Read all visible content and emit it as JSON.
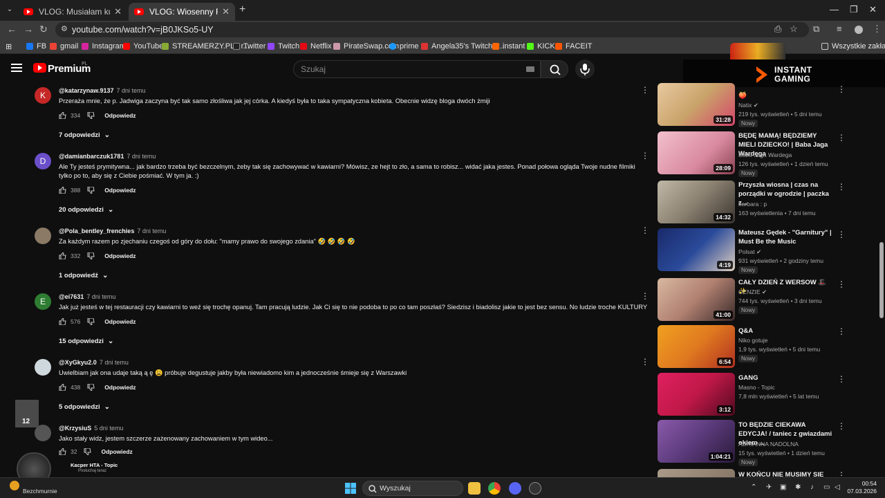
{
  "browser": {
    "tabs": [
      {
        "title": "VLOG: Musiałam kupić drugi ro"
      },
      {
        "title": "VLOG: Wiosenny Reset Pokoju"
      }
    ],
    "url": "youtube.com/watch?v=jB0JKSo5-UY",
    "all_bookmarks_label": "Wszystkie zakładki",
    "bookmarks": [
      {
        "label": "FB",
        "color": "#1877f2"
      },
      {
        "label": "gmail",
        "color": "#ea4335"
      },
      {
        "label": "Instagram",
        "color": "#d6249f"
      },
      {
        "label": "YouTube",
        "color": "#ff0000"
      },
      {
        "label": "STREAMERZY.PL - r...",
        "color": "#8a3"
      },
      {
        "label": "Twitter",
        "color": "#222"
      },
      {
        "label": "Twitch",
        "color": "#9146ff"
      },
      {
        "label": "Netflix",
        "color": "#e50914"
      },
      {
        "label": "PirateSwap.com",
        "color": "#c9a"
      },
      {
        "label": "prime",
        "color": "#1a98ff"
      },
      {
        "label": "Angela35's Twitch R...",
        "color": "#d33"
      },
      {
        "label": "instant",
        "color": "#f60"
      },
      {
        "label": "KICK",
        "color": "#53fc18"
      },
      {
        "label": "FACEIT",
        "color": "#ff5500"
      }
    ]
  },
  "youtube": {
    "logo_text": "Premium",
    "logo_region": "PL",
    "search_placeholder": "Szukaj"
  },
  "ad_banner": {
    "line1": "INSTANT",
    "line2": "GAMING"
  },
  "comments": [
    {
      "author": "@katarzynaw.9137",
      "date": "7 dni temu",
      "text": "Przeraża mnie, że p. Jadwiga zaczyna być tak samo złośliwa jak jej córka. A kiedyś była to taka sympatyczna kobieta. Obecnie widzę bloga dwóch żmiji",
      "likes": "334",
      "reply_label": "Odpowiedz",
      "replies": "7 odpowiedzi",
      "avatar_letter": "K",
      "avatar_color": "#c62828"
    },
    {
      "author": "@damianbarczuk1781",
      "date": "7 dni temu",
      "text": "Ale Ty jesteś prymitywna... jak bardzo trzeba być bezczelnym, żeby tak się zachowywać w kawiarni? Mówisz, ze hejt to zło, a sama to robisz... widać jaka jestes. Ponad połowa ogląda Twoje nudne filmiki tylko po to, aby się z Ciebie pośmiać. W tym ja. :)",
      "likes": "388",
      "reply_label": "Odpowiedz",
      "replies": "20 odpowiedzi",
      "avatar_letter": "D",
      "avatar_color": "#6a4fc9"
    },
    {
      "author": "@Pola_bentley_frenchies",
      "date": "7 dni temu",
      "text": "Za każdym razem po zjechaniu czegoś od góry do dołu: \"mamy prawo do swojego zdania\" 🤣 🤣 🤣 🤣",
      "likes": "332",
      "reply_label": "Odpowiedz",
      "replies": "1 odpowiedź",
      "avatar_letter": "",
      "avatar_color": "#8a7a66"
    },
    {
      "author": "@ei7631",
      "date": "7 dni temu",
      "text": "Jak już jesteś w tej restauracji czy kawiarni to weź się trochę opanuj.  Tam pracują ludzie. Jak Ci się to nie podoba to po co tam poszłaś? Siedzisz i biadolisz jakie to jest bez sensu. No ludzie troche KULTURY",
      "likes": "576",
      "reply_label": "Odpowiedz",
      "replies": "15 odpowiedzi",
      "avatar_letter": "E",
      "avatar_color": "#2e7d32"
    },
    {
      "author": "@XyGkyu2.0",
      "date": "7 dni temu",
      "text": "Uwielbiam jak ona udaje taką ą ę 😩 próbuje degustuje jakby była niewiadomo kim a jednocześnie śmieje się z Warszawki",
      "likes": "438",
      "reply_label": "Odpowiedz",
      "replies": "5 odpowiedzi",
      "avatar_letter": "",
      "avatar_color": "#cfd8dc"
    },
    {
      "author": "@KrzysiuS",
      "date": "5 dni temu",
      "text": "Jako stały widz, jestem szczerze zażenowany zachowaniem w tym wideo...",
      "likes": "32",
      "reply_label": "Odpowiedz",
      "replies": "",
      "avatar_letter": "",
      "avatar_color": "#555"
    }
  ],
  "recommendations": [
    {
      "title": "🍑",
      "channel": "Natix ✔",
      "meta": "219 tys. wyświetleń • 5 dni temu",
      "badge": "Nowy",
      "duration": "31:28",
      "thumb": "#c9a36a"
    },
    {
      "title": "BĘDĘ MAMĄ! BĘDZIEMY MIELI DZIECKO! | Baba Jaga Wardęga",
      "channel": "Baba Jaga Wardega",
      "meta": "126 tys. wyświetleń • 1 dzień temu",
      "badge": "Nowy",
      "duration": "28:09",
      "thumb": "#d98aa0"
    },
    {
      "title": "Przyszła wiosna | czas na porządki w ogrodzie | paczka z...",
      "channel": "barbara : p",
      "meta": "163 wyświetlenia • 7 dni temu",
      "badge": "",
      "duration": "14:32",
      "thumb": "#8a8070"
    },
    {
      "title": "Mateusz Gędek - \"Garnitury\" | Must Be the Music",
      "channel": "Polsat ✔",
      "meta": "931 wyświetleń • 2 godziny temu",
      "badge": "Nowy",
      "duration": "4:19",
      "thumb": "#2a4a9a"
    },
    {
      "title": "CAŁY DZIEŃ Z WERSOW 🎩 ✨",
      "channel": "GENZIE ✔",
      "meta": "744 tys. wyświetleń • 3 dni temu",
      "badge": "Nowy",
      "duration": "41:00",
      "thumb": "#b08070"
    },
    {
      "title": "Q&A",
      "channel": "Niko gotuje",
      "meta": "1,9 tys. wyświetleń • 5 dni temu",
      "badge": "Nowy",
      "duration": "6:54",
      "thumb": "#e07a20"
    },
    {
      "title": "GANG",
      "channel": "Masno - Topic",
      "meta": "7,8 mln wyświetleń • 5 lat temu",
      "badge": "",
      "duration": "3:12",
      "thumb": "#c01848"
    },
    {
      "title": "TO BĘDZIE CIEKAWA EDYCJA! / taniec z gwiazdami okiem ...",
      "channel": "ADRIANNA NADOLNA",
      "meta": "15 tys. wyświetleń • 1 dzień temu",
      "badge": "Nowy",
      "duration": "1:04:21",
      "thumb": "#5a3a7a"
    },
    {
      "title": "W KOŃCU NIE MUSIMY SIE",
      "channel": "",
      "meta": "",
      "badge": "",
      "duration": "",
      "thumb": "#7a6a5a"
    }
  ],
  "overlay": {
    "stream_count": "12",
    "mini_title": "Kacper HTA - Topic",
    "mini_sub": "Posłuchaj teraz"
  },
  "taskbar": {
    "weather_label": "Bezchmurnie",
    "search_label": "Wyszukaj",
    "time": "00:54",
    "date": "07.03.2026"
  }
}
